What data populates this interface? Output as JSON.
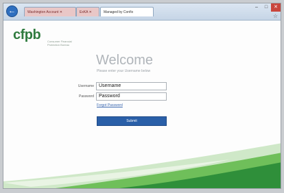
{
  "browser": {
    "tabs": [
      {
        "label": "Washington Account ✕"
      },
      {
        "label": "ExKA ✕"
      },
      {
        "label": "Managed by Confix"
      }
    ],
    "window_controls": [
      "–",
      "□",
      "✕"
    ]
  },
  "brand": {
    "logo": "cfpb",
    "subtitle": "Consumer Financial Protection Bureau",
    "green": "#2f7b3e"
  },
  "login": {
    "welcome": "Welcome",
    "instructions": "Please enter your Username below",
    "username_label": "Username",
    "username_value": "Username",
    "password_label": "Password",
    "password_value": "Password",
    "forgot_link": "Forgot Password",
    "submit_label": "Submit"
  }
}
